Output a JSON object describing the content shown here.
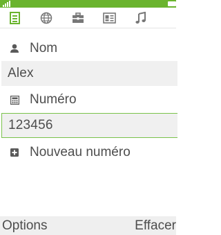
{
  "status": {
    "signal_icon": "signal-bars-icon",
    "battery_icon": "battery-icon",
    "accent_color": "#6ab42e"
  },
  "tabs": [
    {
      "icon": "document-icon",
      "active": true
    },
    {
      "icon": "globe-icon",
      "active": false
    },
    {
      "icon": "briefcase-icon",
      "active": false
    },
    {
      "icon": "contact-card-icon",
      "active": false
    },
    {
      "icon": "music-note-icon",
      "active": false
    }
  ],
  "form": {
    "name_label": "Nom",
    "name_value": "Alex",
    "number_label": "Numéro",
    "number_value": "123456",
    "add_number_label": "Nouveau numéro"
  },
  "softkeys": {
    "left": "Options",
    "right": "Effacer"
  }
}
